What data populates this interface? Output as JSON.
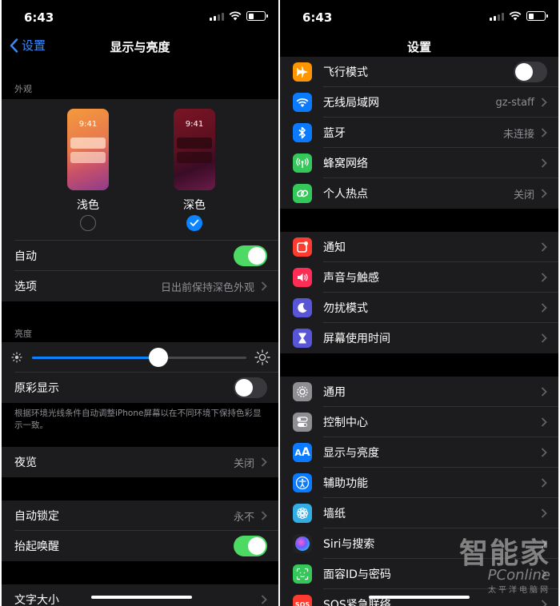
{
  "left": {
    "status": {
      "time": "6:43"
    },
    "nav": {
      "back_label": "设置",
      "title": "显示与亮度"
    },
    "appearance": {
      "header": "外观",
      "light": {
        "label": "浅色",
        "preview_time": "9:41"
      },
      "dark": {
        "label": "深色",
        "preview_time": "9:41"
      },
      "selected": "dark"
    },
    "auto_row": {
      "label": "自动",
      "on": true
    },
    "options_row": {
      "label": "选项",
      "value": "日出前保持深色外观"
    },
    "brightness": {
      "header": "亮度",
      "level_percent": 59
    },
    "true_tone": {
      "label": "原彩显示",
      "on": false,
      "footnote": "根据环境光线条件自动调整iPhone屏幕以在不同环境下保持色彩显示一致。"
    },
    "night_shift": {
      "label": "夜览",
      "value": "关闭"
    },
    "auto_lock": {
      "label": "自动锁定",
      "value": "永不"
    },
    "raise_to_wake": {
      "label": "抬起唤醒",
      "on": true
    },
    "text_size": {
      "label": "文字大小"
    }
  },
  "right": {
    "status": {
      "time": "6:43"
    },
    "nav": {
      "title": "设置"
    },
    "group1": [
      {
        "label": "飞行模式",
        "icon": "airplane-icon",
        "color": "#ff9500",
        "toggle": false
      },
      {
        "label": "无线局域网",
        "icon": "wifi-icon",
        "color": "#0a7aff",
        "value": "gz-staff"
      },
      {
        "label": "蓝牙",
        "icon": "bluetooth-icon",
        "color": "#0a7aff",
        "value": "未连接"
      },
      {
        "label": "蜂窝网络",
        "icon": "cellular-icon",
        "color": "#34c759"
      },
      {
        "label": "个人热点",
        "icon": "hotspot-icon",
        "color": "#34c759",
        "value": "关闭"
      }
    ],
    "group2": [
      {
        "label": "通知",
        "icon": "notifications-icon",
        "color": "#ff3b30"
      },
      {
        "label": "声音与触感",
        "icon": "speaker-icon",
        "color": "#ff2d55"
      },
      {
        "label": "勿扰模式",
        "icon": "moon-icon",
        "color": "#5856d6"
      },
      {
        "label": "屏幕使用时间",
        "icon": "hourglass-icon",
        "color": "#5856d6"
      }
    ],
    "group3": [
      {
        "label": "通用",
        "icon": "gear-icon",
        "color": "#8e8e93"
      },
      {
        "label": "控制中心",
        "icon": "switches-icon",
        "color": "#8e8e93"
      },
      {
        "label": "显示与亮度",
        "icon": "text-size-icon",
        "color": "#0a7aff"
      },
      {
        "label": "辅助功能",
        "icon": "accessibility-icon",
        "color": "#0a7aff"
      },
      {
        "label": "墙纸",
        "icon": "flower-icon",
        "color": "#32ade6"
      },
      {
        "label": "Siri与搜索",
        "icon": "siri-icon",
        "color": "#222222"
      },
      {
        "label": "面容ID与密码",
        "icon": "face-id-icon",
        "color": "#34c759"
      },
      {
        "label": "SOS紧急联络",
        "icon": "sos-icon",
        "color": "#ff3b30"
      }
    ]
  },
  "watermark": {
    "line1": "智能家",
    "line2": "PConline",
    "line3": "太平洋电脑网"
  }
}
